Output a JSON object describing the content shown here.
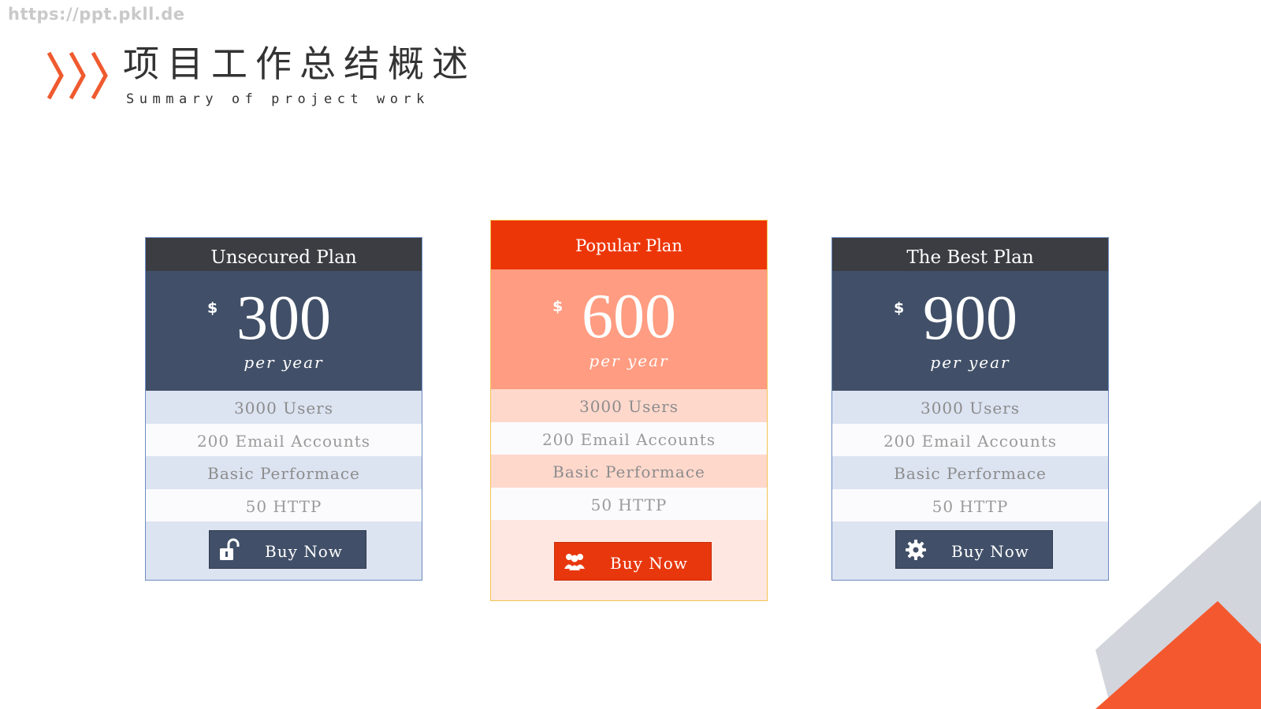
{
  "watermark": "https://ppt.pkll.de",
  "title": {
    "cn": "项目工作总结概述",
    "en": "Summary of project work"
  },
  "colors": {
    "accent": "#ed3608",
    "navy": "#415068",
    "header_dark": "#3b3d42",
    "salmon": "#ff9c81",
    "grey_deco": "#d3d5dc",
    "orange_deco": "#f4582e"
  },
  "plans": [
    {
      "name": "Unsecured Plan",
      "currency": "$",
      "price": "300",
      "period": "per year",
      "features": [
        "3000 Users",
        "200 Email Accounts",
        "Basic Performace",
        "50 HTTP"
      ],
      "button": "Buy Now",
      "icon": "unlock-icon"
    },
    {
      "name": "Popular Plan",
      "currency": "$",
      "price": "600",
      "period": "per year",
      "features": [
        "3000 Users",
        "200 Email Accounts",
        "Basic Performace",
        "50 HTTP"
      ],
      "button": "Buy Now",
      "icon": "users-icon"
    },
    {
      "name": "The Best Plan",
      "currency": "$",
      "price": "900",
      "period": "per year",
      "features": [
        "3000 Users",
        "200 Email Accounts",
        "Basic Performace",
        "50 HTTP"
      ],
      "button": "Buy Now",
      "icon": "gear-icon"
    }
  ]
}
